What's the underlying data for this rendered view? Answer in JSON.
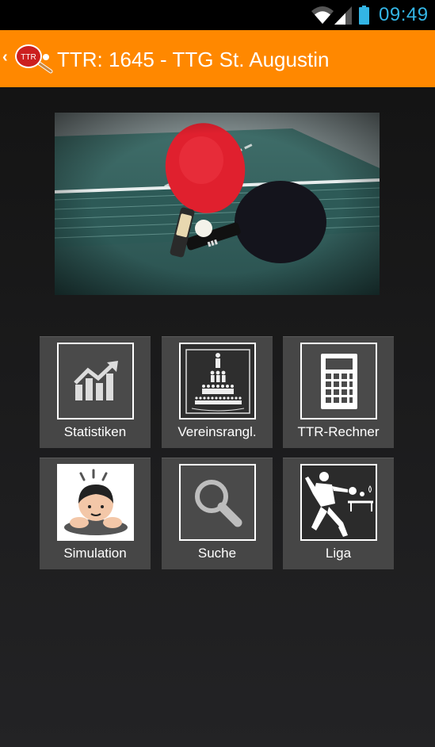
{
  "status_bar": {
    "time": "09:49",
    "time_color": "#33b5e5"
  },
  "action_bar": {
    "title": "TTR: 1645 - TTG St. Augustin",
    "logo_text": "TTR",
    "background": "#ff8800"
  },
  "menu": [
    {
      "id": "statistiken",
      "label": "Statistiken",
      "icon": "chart-icon"
    },
    {
      "id": "vereinsrangl",
      "label": "Vereinsrangl.",
      "icon": "pyramid-people-icon"
    },
    {
      "id": "ttr-rechner",
      "label": "TTR-Rechner",
      "icon": "calculator-icon"
    },
    {
      "id": "simulation",
      "label": "Simulation",
      "icon": "person-emoji-icon"
    },
    {
      "id": "suche",
      "label": "Suche",
      "icon": "search-icon"
    },
    {
      "id": "liga",
      "label": "Liga",
      "icon": "table-tennis-player-icon"
    }
  ]
}
